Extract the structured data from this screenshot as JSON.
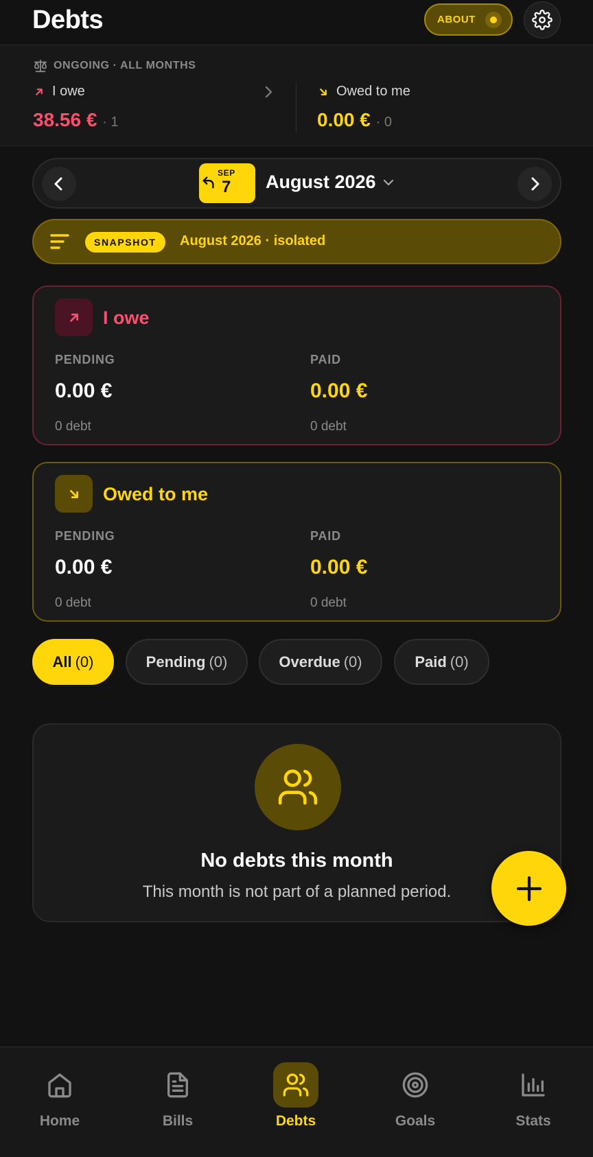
{
  "header": {
    "title": "Debts",
    "about_label": "ABOUT"
  },
  "summary": {
    "caption": "ONGOING · ALL MONTHS",
    "i_owe": {
      "label": "I owe",
      "amount": "38.56 €",
      "count": "· 1"
    },
    "owed_to_me": {
      "label": "Owed to me",
      "amount": "0.00 €",
      "count": "· 0"
    }
  },
  "month_nav": {
    "chip_month": "SEP",
    "chip_day": "7",
    "label": "August 2026"
  },
  "snapshot": {
    "badge": "SNAPSHOT",
    "text": "August 2026 · isolated"
  },
  "cards": {
    "owe": {
      "title": "I owe",
      "pending_label": "PENDING",
      "pending_value": "0.00 €",
      "pending_sub": "0 debt",
      "paid_label": "PAID",
      "paid_value": "0.00 €",
      "paid_sub": "0 debt"
    },
    "owed": {
      "title": "Owed to me",
      "pending_label": "PENDING",
      "pending_value": "0.00 €",
      "pending_sub": "0 debt",
      "paid_label": "PAID",
      "paid_value": "0.00 €",
      "paid_sub": "0 debt"
    }
  },
  "filters": [
    {
      "label": "All",
      "count": "(0)"
    },
    {
      "label": "Pending",
      "count": "(0)"
    },
    {
      "label": "Overdue",
      "count": "(0)"
    },
    {
      "label": "Paid",
      "count": "(0)"
    }
  ],
  "empty": {
    "title": "No debts this month",
    "subtitle": "This month is not part of a planned period."
  },
  "bottom_nav": [
    {
      "label": "Home",
      "icon": "home-icon"
    },
    {
      "label": "Bills",
      "icon": "document-icon"
    },
    {
      "label": "Debts",
      "icon": "users-icon"
    },
    {
      "label": "Goals",
      "icon": "target-icon"
    },
    {
      "label": "Stats",
      "icon": "bar-chart-icon"
    }
  ],
  "colors": {
    "accent": "#ffd60a",
    "negative": "#ff4d6d",
    "background": "#121212"
  }
}
